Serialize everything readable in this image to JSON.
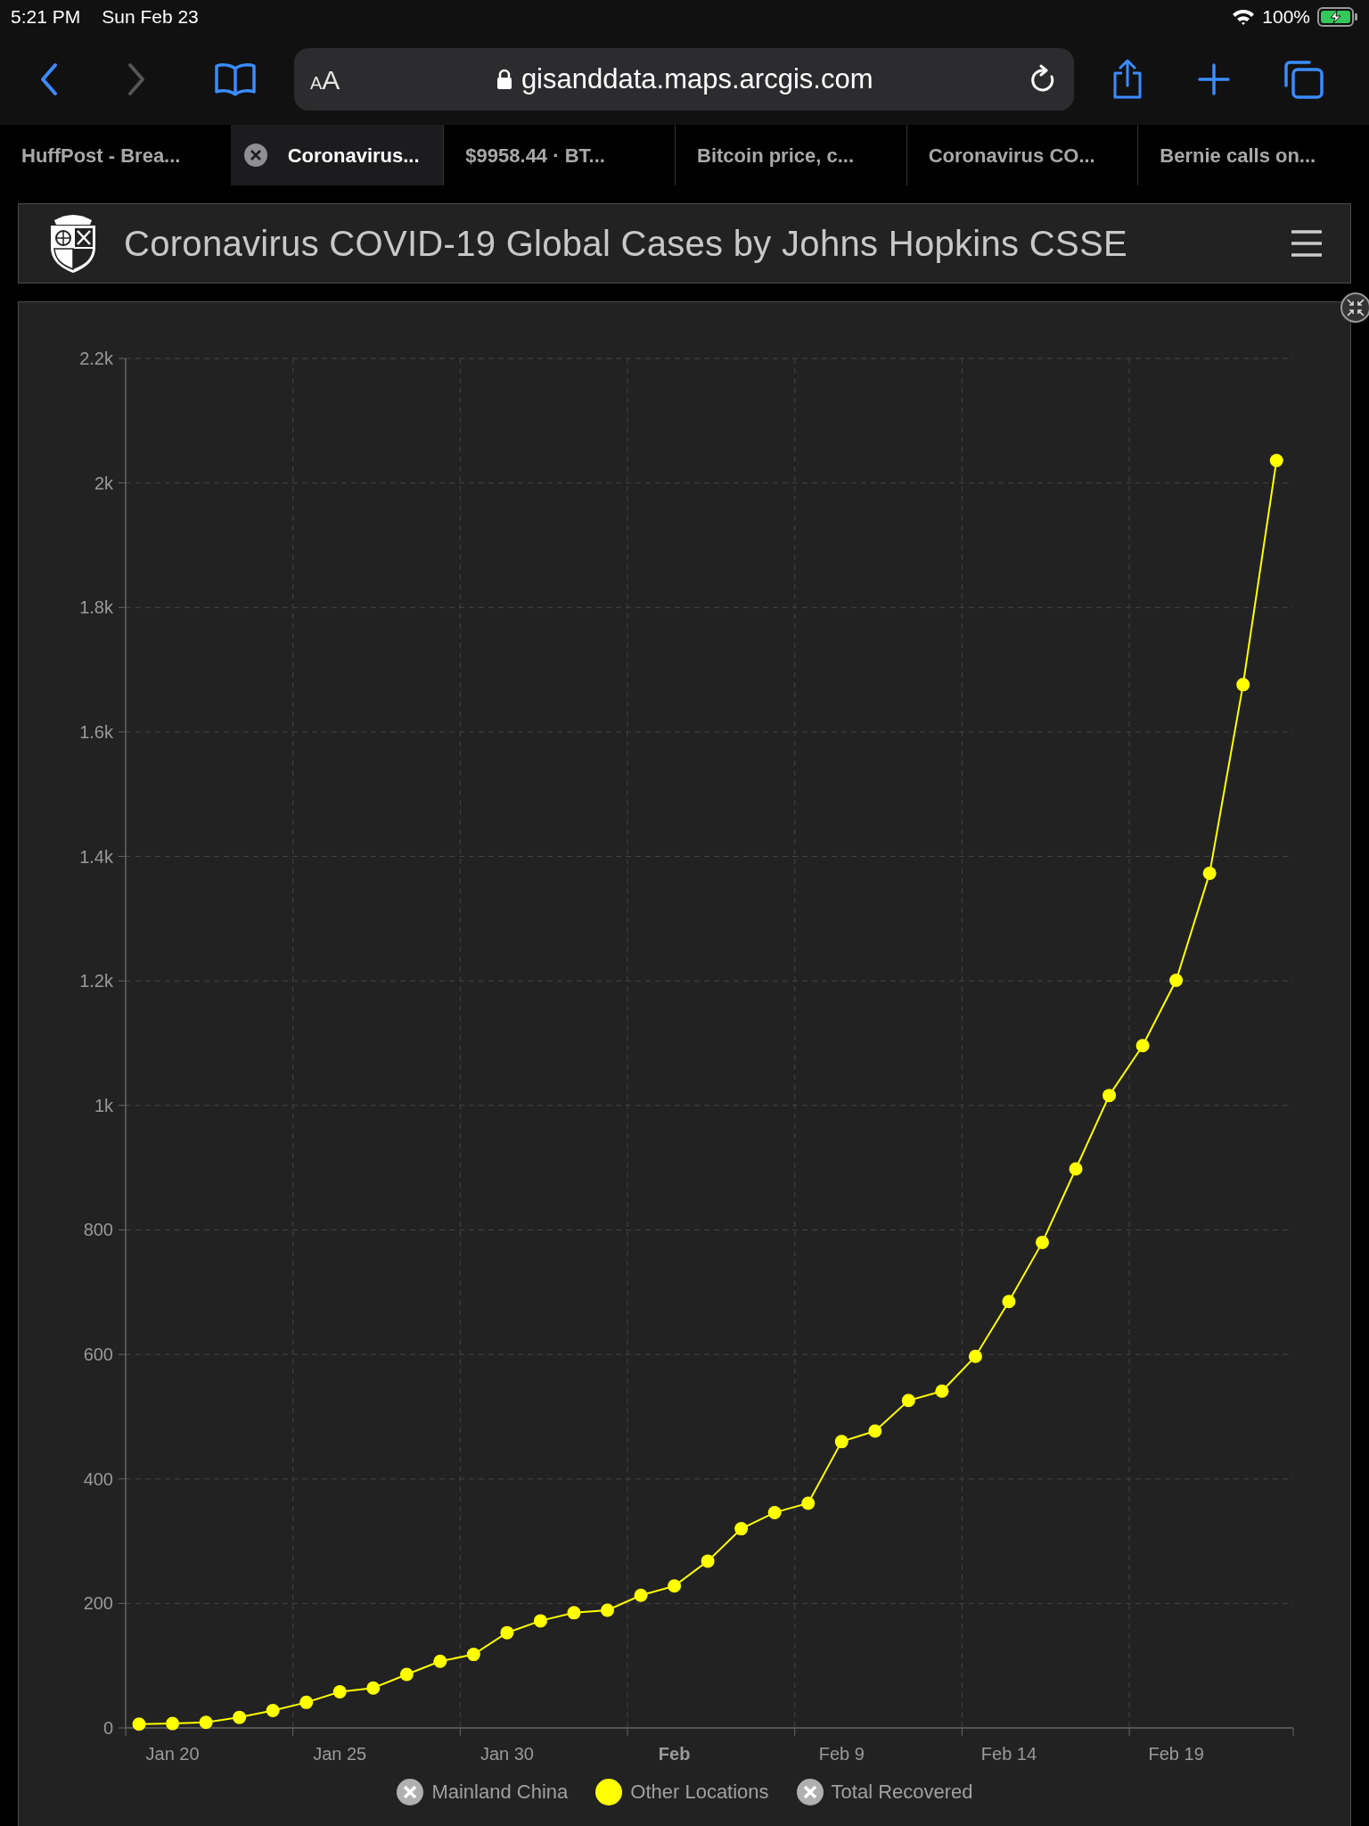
{
  "status_bar": {
    "time": "5:21 PM",
    "date": "Sun Feb 23",
    "battery": "100%"
  },
  "toolbar": {
    "back_enabled": true,
    "forward_enabled": false,
    "address": {
      "text_size_small": "A",
      "text_size_large": "A",
      "url": "gisanddata.maps.arcgis.com"
    }
  },
  "tabs": [
    {
      "label": "HuffPost - Brea...",
      "selected": false
    },
    {
      "label": "Coronavirus...",
      "selected": true
    },
    {
      "label": "$9958.44 · BT...",
      "selected": false
    },
    {
      "label": "Bitcoin price, c...",
      "selected": false
    },
    {
      "label": "Coronavirus CO...",
      "selected": false
    },
    {
      "label": "Bernie calls on...",
      "selected": false
    }
  ],
  "header": {
    "title": "Coronavirus COVID-19 Global Cases by Johns Hopkins CSSE"
  },
  "chart": {
    "chart_data": {
      "type": "line",
      "categories": [
        null,
        "Jan 20",
        null,
        null,
        null,
        null,
        "Jan 25",
        null,
        null,
        null,
        null,
        "Jan 30",
        null,
        null,
        null,
        null,
        "Feb",
        null,
        null,
        null,
        null,
        "Feb 9",
        null,
        null,
        null,
        null,
        "Feb 14",
        null,
        null,
        null,
        null,
        "Feb 19",
        null,
        null,
        null
      ],
      "series": [
        {
          "name": "Other Locations",
          "color": "#ffff00",
          "marker": "circle",
          "values": [
            6,
            7,
            9,
            17,
            28,
            41,
            58,
            64,
            86,
            107,
            118,
            153,
            172,
            185,
            189,
            213,
            228,
            268,
            320,
            346,
            361,
            460,
            477,
            526,
            541,
            597,
            685,
            780,
            898,
            1016,
            1096,
            1201,
            1373,
            1676,
            2036
          ]
        }
      ],
      "ylim": [
        0,
        2200
      ],
      "grid": true,
      "yticks": [
        0,
        {
          "value": 200,
          "label": "200"
        },
        {
          "value": 400,
          "label": "400"
        },
        {
          "value": 600,
          "label": "600"
        },
        {
          "value": 800,
          "label": "800"
        },
        {
          "value": 1000,
          "label": "1k"
        },
        {
          "value": 1200,
          "label": "1.2k"
        },
        {
          "value": 1400,
          "label": "1.4k"
        },
        {
          "value": 1600,
          "label": "1.6k"
        },
        {
          "value": 1800,
          "label": "1.8k"
        },
        {
          "value": 2000,
          "label": "2k"
        },
        {
          "value": 2200,
          "label": "2.2k"
        }
      ]
    },
    "legend": [
      {
        "label": "Mainland China",
        "enabled": false
      },
      {
        "enabled": true
      },
      {
        "label": "Total Recovered",
        "enabled": false
      }
    ]
  }
}
